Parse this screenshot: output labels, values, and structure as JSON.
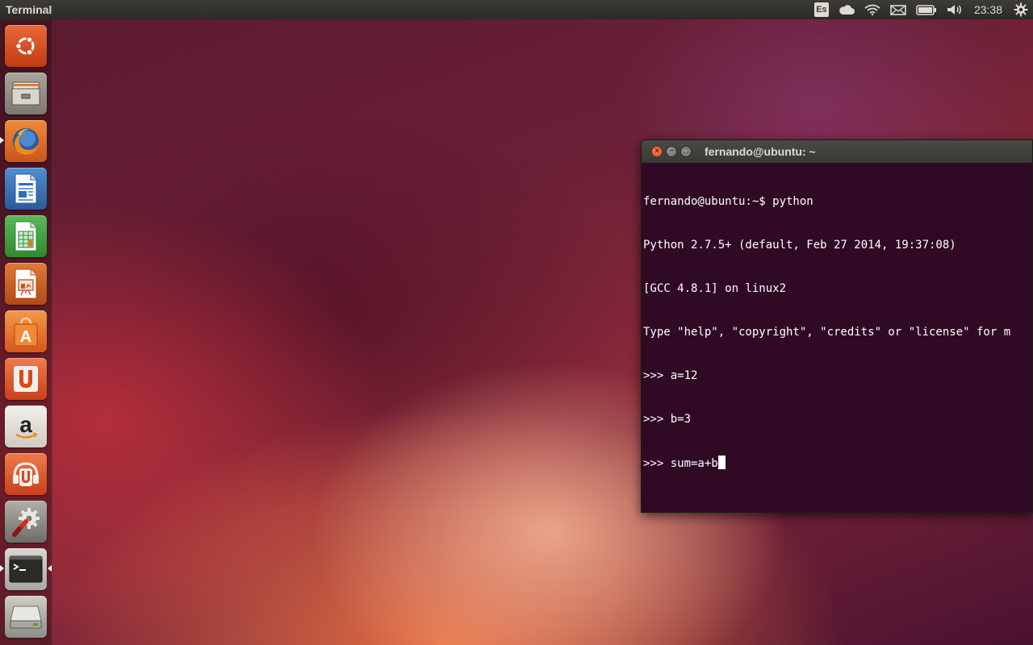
{
  "top_panel": {
    "app_title": "Terminal",
    "keyboard_layout": "Es",
    "clock": "23:38",
    "icons": [
      "keyboard-layout-icon",
      "cloud-icon",
      "wifi-icon",
      "mail-icon",
      "battery-icon",
      "volume-icon",
      "gear-icon"
    ]
  },
  "launcher": {
    "items": [
      {
        "name": "Dash",
        "icon": "ubuntu-logo-icon",
        "color": "#dd4814"
      },
      {
        "name": "Files",
        "icon": "file-cabinet-icon",
        "color": "#8f8a80"
      },
      {
        "name": "Firefox Web Browser",
        "icon": "firefox-icon",
        "color": "#e8731a",
        "running": true
      },
      {
        "name": "LibreOffice Writer",
        "icon": "writer-document-icon",
        "color": "#2f6fb3"
      },
      {
        "name": "LibreOffice Calc",
        "icon": "calc-spreadsheet-icon",
        "color": "#3a9a3a"
      },
      {
        "name": "LibreOffice Impress",
        "icon": "impress-presentation-icon",
        "color": "#c9561c"
      },
      {
        "name": "Ubuntu Software Center",
        "icon": "software-center-bag-icon",
        "color": "#e86a1e"
      },
      {
        "name": "Ubuntu One",
        "icon": "ubuntu-one-icon",
        "color": "#e0531c"
      },
      {
        "name": "Amazon",
        "icon": "amazon-icon",
        "color": "#e8e6e2"
      },
      {
        "name": "Ubuntu One Music",
        "icon": "ubuntu-one-music-icon",
        "color": "#e0531c"
      },
      {
        "name": "System Settings",
        "icon": "settings-tools-icon",
        "color": "#9a9894"
      },
      {
        "name": "Terminal",
        "icon": "terminal-icon",
        "color": "#3c3b37",
        "running": true,
        "focused": true
      },
      {
        "name": "Removable Drive",
        "icon": "drive-icon",
        "color": "#b8b6b0"
      }
    ]
  },
  "terminal": {
    "window_title": "fernando@ubuntu: ~",
    "lines": [
      "fernando@ubuntu:~$ python",
      "Python 2.7.5+ (default, Feb 27 2014, 19:37:08)",
      "[GCC 4.8.1] on linux2",
      "Type \"help\", \"copyright\", \"credits\" or \"license\" for m",
      ">>> a=12",
      ">>> b=3"
    ],
    "current_input": ">>> sum=a+b",
    "colors": {
      "background": "#300a24",
      "foreground": "#ffffff"
    }
  }
}
